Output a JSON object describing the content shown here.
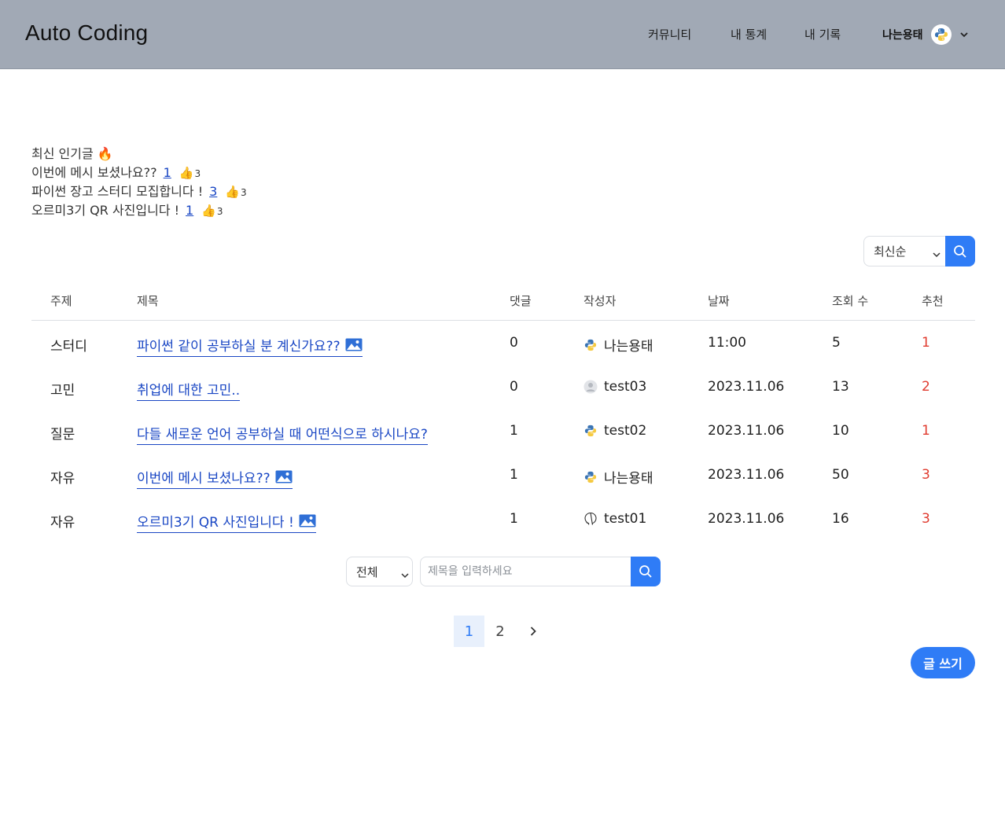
{
  "header": {
    "brand": "Auto Coding",
    "nav": [
      "커뮤니티",
      "내 통계",
      "내 기록"
    ],
    "user_name": "나는용태",
    "bg_color": "#a1a9b5"
  },
  "popular": {
    "heading": "최신 인기글",
    "heading_icon": "🔥",
    "items": [
      {
        "title": "이번에 메시 보셨나요??",
        "comments": "1",
        "icon": "👍",
        "likes": "3"
      },
      {
        "title": "파이썬 장고 스터디 모집합니다 !",
        "comments": "3",
        "icon": "👍",
        "likes": "3"
      },
      {
        "title": "오르미3기 QR 사진입니다 !",
        "comments": "1",
        "icon": "👍",
        "likes": "3"
      }
    ]
  },
  "sort": {
    "selected": "최신순"
  },
  "table": {
    "headers": [
      "주제",
      "제목",
      "댓글",
      "작성자",
      "날짜",
      "조회 수",
      "추천"
    ],
    "rows": [
      {
        "topic": "스터디",
        "title": "파이썬 같이 공부하실 분 계신가요??",
        "has_image": true,
        "comments": "0",
        "author": "나는용태",
        "avatar": "python-icon",
        "date": "11:00",
        "views": "5",
        "recommend": "1"
      },
      {
        "topic": "고민",
        "title": "취업에 대한 고민..",
        "has_image": false,
        "comments": "0",
        "author": "test03",
        "avatar": "default-user-icon",
        "date": "2023.11.06",
        "views": "13",
        "recommend": "2"
      },
      {
        "topic": "질문",
        "title": "다들 새로운 언어 공부하실 때 어떤식으로 하시나요?",
        "has_image": false,
        "comments": "1",
        "author": "test02",
        "avatar": "python-icon",
        "date": "2023.11.06",
        "views": "10",
        "recommend": "1"
      },
      {
        "topic": "자유",
        "title": "이번에 메시 보셨나요??",
        "has_image": true,
        "comments": "1",
        "author": "나는용태",
        "avatar": "python-icon",
        "date": "2023.11.06",
        "views": "50",
        "recommend": "3"
      },
      {
        "topic": "자유",
        "title": "오르미3기 QR 사진입니다 !",
        "has_image": true,
        "comments": "1",
        "author": "test01",
        "avatar": "github-icon",
        "date": "2023.11.06",
        "views": "16",
        "recommend": "3"
      }
    ]
  },
  "search": {
    "category": "전체",
    "placeholder": "제목을 입력하세요"
  },
  "pagination": {
    "pages": [
      "1",
      "2"
    ],
    "current": "1"
  },
  "write_button": "글 쓰기",
  "colors": {
    "accent": "#2f7cf6",
    "link": "#1a47c4",
    "recommend": "#e03b2f"
  }
}
